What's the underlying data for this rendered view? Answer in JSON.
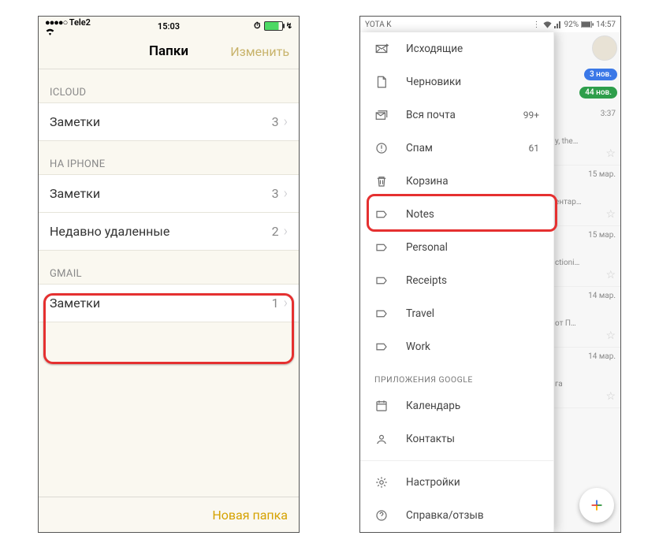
{
  "left": {
    "status": {
      "carrier": "Tele2",
      "time": "15:03"
    },
    "nav": {
      "title": "Папки",
      "edit": "Изменить"
    },
    "sections": {
      "icloud": {
        "header": "ICLOUD",
        "rows": [
          {
            "label": "Заметки",
            "count": "3"
          }
        ]
      },
      "iphone": {
        "header": "НА IPHONE",
        "rows": [
          {
            "label": "Заметки",
            "count": "3"
          },
          {
            "label": "Недавно удаленные",
            "count": "2"
          }
        ]
      },
      "gmail": {
        "header": "GMAIL",
        "rows": [
          {
            "label": "Заметки",
            "count": "1"
          }
        ]
      }
    },
    "footer": {
      "new_folder": "Новая папка"
    }
  },
  "right": {
    "status": {
      "carrier": "YOTA K",
      "battery": "92%",
      "time": "14:57"
    },
    "items": [
      {
        "label": "Исходящие",
        "count": ""
      },
      {
        "label": "Черновики",
        "count": ""
      },
      {
        "label": "Вся почта",
        "count": "99+"
      },
      {
        "label": "Спам",
        "count": "61"
      },
      {
        "label": "Корзина",
        "count": ""
      },
      {
        "label": "Notes",
        "count": ""
      },
      {
        "label": "Personal",
        "count": ""
      },
      {
        "label": "Receipts",
        "count": ""
      },
      {
        "label": "Travel",
        "count": ""
      },
      {
        "label": "Work",
        "count": ""
      }
    ],
    "section_apps": "ПРИЛОЖЕНИЯ GOOGLE",
    "apps": [
      {
        "label": "Календарь"
      },
      {
        "label": "Контакты"
      }
    ],
    "settings": "Настройки",
    "help": "Справка/отзыв",
    "inbox_peek": {
      "badges": {
        "blue": "3 нов.",
        "green": "44 нов."
      },
      "rows": [
        {
          "date": "3:37",
          "snip": "y, the…"
        },
        {
          "date": "15 мар.",
          "snip": "ентар…"
        },
        {
          "date": "15 мар.",
          "snip": "ctioni…"
        },
        {
          "date": "14 мар.",
          "snip": "от П…"
        },
        {
          "date": "14 мар.",
          "snip": "гa"
        }
      ]
    }
  }
}
